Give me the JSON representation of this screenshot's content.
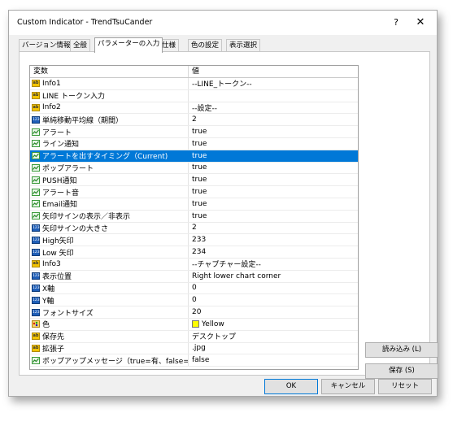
{
  "window": {
    "title": "Custom Indicator - TrendTsuCander",
    "help": "?",
    "close": "✕"
  },
  "tabs": [
    {
      "label": "バージョン情報"
    },
    {
      "label": "全般"
    },
    {
      "label": "パラメーターの入力"
    },
    {
      "label": "仕様"
    },
    {
      "label": "色の設定"
    },
    {
      "label": "表示選択"
    }
  ],
  "active_tab": 2,
  "grid": {
    "header": {
      "variable": "変数",
      "value": "値"
    },
    "rows": [
      {
        "icon": "ab",
        "name": "Info1",
        "value": "--LINE_トークン--"
      },
      {
        "icon": "ab",
        "name": "LINE トークン入力",
        "value": ""
      },
      {
        "icon": "ab",
        "name": "Info2",
        "value": "--設定--"
      },
      {
        "icon": "123",
        "name": "単純移動平均線（期間）",
        "value": "2"
      },
      {
        "icon": "bool",
        "name": "アラート",
        "value": "true"
      },
      {
        "icon": "bool",
        "name": "ライン通知",
        "value": "true"
      },
      {
        "icon": "bool",
        "name": "アラートを出すタイミング（Current)",
        "value": "true",
        "selected": true
      },
      {
        "icon": "bool",
        "name": "ポップアラート",
        "value": "true"
      },
      {
        "icon": "bool",
        "name": "PUSH通知",
        "value": "true"
      },
      {
        "icon": "bool",
        "name": "アラート音",
        "value": "true"
      },
      {
        "icon": "bool",
        "name": "Email通知",
        "value": "true"
      },
      {
        "icon": "bool",
        "name": "矢印サインの表示／非表示",
        "value": "true"
      },
      {
        "icon": "123",
        "name": "矢印サインの大きさ",
        "value": "2"
      },
      {
        "icon": "123",
        "name": "High矢印",
        "value": "233"
      },
      {
        "icon": "123",
        "name": "Low 矢印",
        "value": "234"
      },
      {
        "icon": "ab",
        "name": "Info3",
        "value": "--チャプチャー設定--"
      },
      {
        "icon": "123",
        "name": "表示位置",
        "value": "Right lower chart corner"
      },
      {
        "icon": "123",
        "name": "X軸",
        "value": "0"
      },
      {
        "icon": "123",
        "name": "Y軸",
        "value": "0"
      },
      {
        "icon": "123",
        "name": "フォントサイズ",
        "value": "20"
      },
      {
        "icon": "color",
        "name": "色",
        "value": "Yellow",
        "swatch": "#ffff00"
      },
      {
        "icon": "ab",
        "name": "保存先",
        "value": "デスクトップ"
      },
      {
        "icon": "ab",
        "name": "拡張子",
        "value": ".jpg"
      },
      {
        "icon": "bool",
        "name": "ポップアップメッセージ（true=有、false=無）",
        "value": "false"
      }
    ]
  },
  "side_buttons": {
    "load": "読み込み (L)",
    "save": "保存 (S)"
  },
  "bottom_buttons": {
    "ok": "OK",
    "cancel": "キャンセル",
    "reset": "リセット"
  },
  "colors": {
    "selection": "#0078d7",
    "dialog_bg": "#f0f0f0"
  }
}
